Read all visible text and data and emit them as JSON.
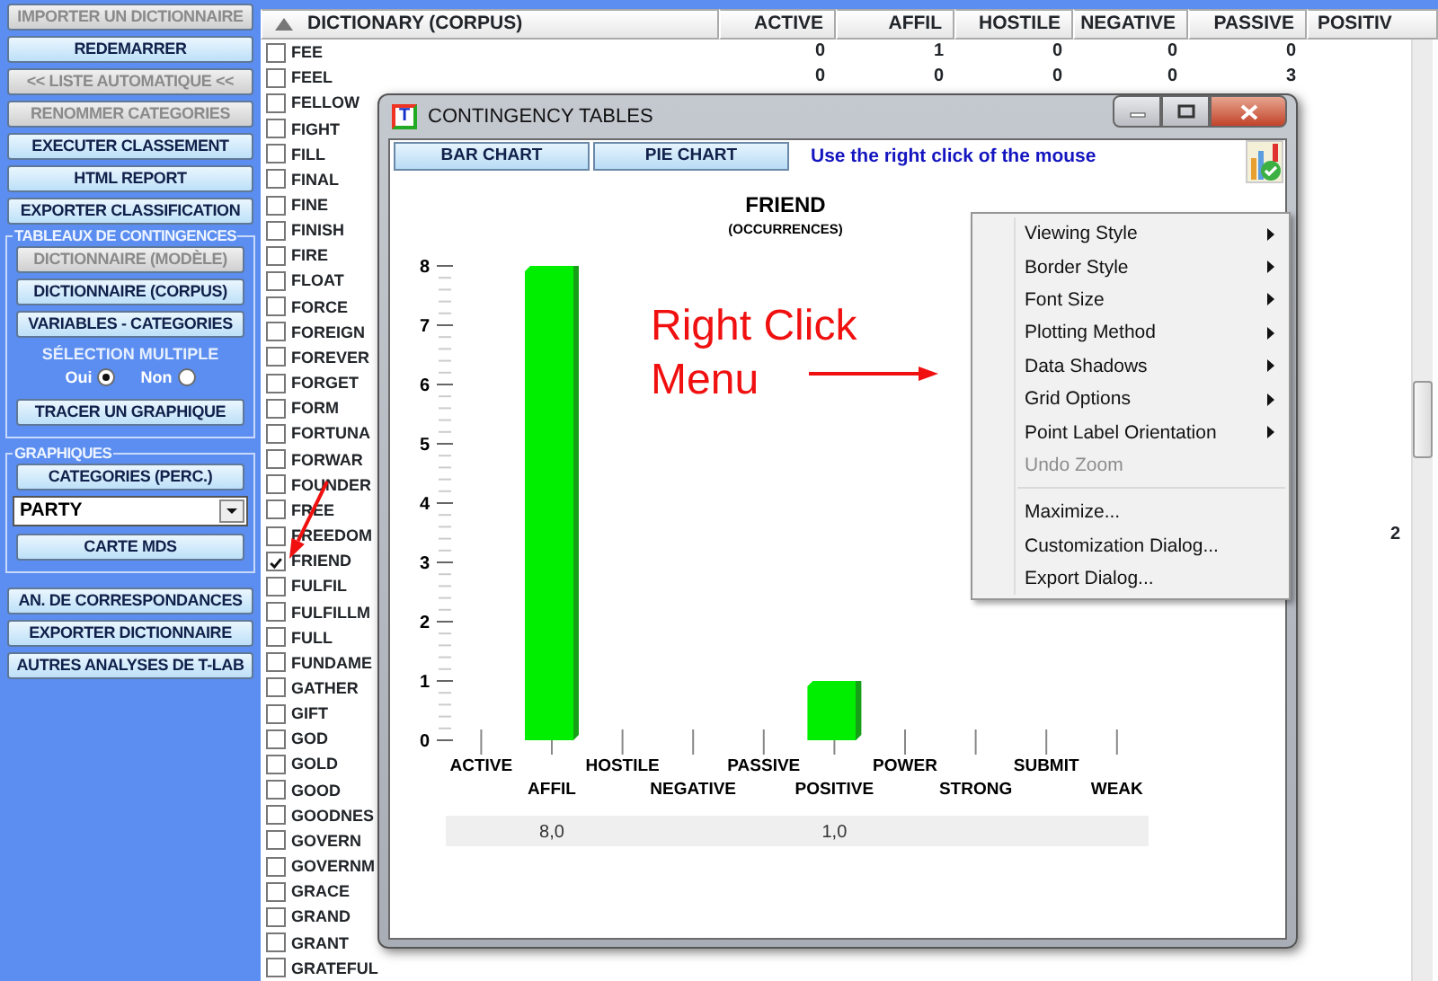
{
  "sidebar": {
    "top_buttons": [
      {
        "label": "IMPORTER UN DICTIONNAIRE",
        "disabled": true
      },
      {
        "label": "REDEMARRER",
        "disabled": false
      },
      {
        "label": "<< LISTE AUTOMATIQUE <<",
        "disabled": true
      },
      {
        "label": "RENOMMER CATEGORIES",
        "disabled": true
      },
      {
        "label": "EXECUTER CLASSEMENT",
        "disabled": false
      },
      {
        "label": "HTML REPORT",
        "disabled": false
      },
      {
        "label": "EXPORTER CLASSIFICATION",
        "disabled": false
      }
    ],
    "contingency_group": {
      "title": "TABLEAUX DE CONTINGENCES",
      "buttons": [
        {
          "label": "DICTIONNAIRE (MODÈLE)",
          "disabled": true
        },
        {
          "label": "DICTIONNAIRE (CORPUS)",
          "disabled": false
        },
        {
          "label": "VARIABLES - CATEGORIES",
          "disabled": false
        }
      ],
      "multi_select": {
        "label": "SÉLECTION MULTIPLE",
        "options": [
          {
            "label": "Oui",
            "selected": true
          },
          {
            "label": "Non",
            "selected": false
          }
        ]
      },
      "plot_button": {
        "label": "TRACER UN GRAPHIQUE",
        "disabled": false
      }
    },
    "graphics_group": {
      "title": "GRAPHIQUES",
      "buttons_before": [
        {
          "label": "CATEGORIES  (PERC.)",
          "disabled": false
        }
      ],
      "select": {
        "value": "PARTY"
      },
      "buttons_after": [
        {
          "label": "CARTE  MDS",
          "disabled": false
        }
      ]
    },
    "bottom_buttons": [
      {
        "label": "AN. DE CORRESPONDANCES",
        "disabled": false
      },
      {
        "label": "EXPORTER DICTIONNAIRE",
        "disabled": false
      },
      {
        "label": "AUTRES ANALYSES DE T-LAB",
        "disabled": false
      }
    ]
  },
  "table": {
    "columns": [
      "DICTIONARY (CORPUS)",
      "ACTIVE",
      "AFFIL",
      "HOSTILE",
      "NEGATIVE",
      "PASSIVE",
      "POSITIV"
    ],
    "rows": [
      {
        "word": "FEE",
        "checked": false,
        "values": [
          "0",
          "1",
          "0",
          "0",
          "0"
        ]
      },
      {
        "word": "FEEL",
        "checked": false,
        "values": [
          "0",
          "0",
          "0",
          "0",
          "3"
        ]
      },
      {
        "word": "FELLOW",
        "checked": false
      },
      {
        "word": "FIGHT",
        "checked": false
      },
      {
        "word": "FILL",
        "checked": false
      },
      {
        "word": "FINAL",
        "checked": false
      },
      {
        "word": "FINE",
        "checked": false
      },
      {
        "word": "FINISH",
        "checked": false
      },
      {
        "word": "FIRE",
        "checked": false
      },
      {
        "word": "FLOAT",
        "checked": false
      },
      {
        "word": "FORCE",
        "checked": false
      },
      {
        "word": "FOREIGN",
        "checked": false
      },
      {
        "word": "FOREVER",
        "checked": false
      },
      {
        "word": "FORGET",
        "checked": false
      },
      {
        "word": "FORM",
        "checked": false
      },
      {
        "word": "FORTUNA",
        "checked": false
      },
      {
        "word": "FORWAR",
        "checked": false
      },
      {
        "word": "FOUNDER",
        "checked": false
      },
      {
        "word": "FREE",
        "checked": false
      },
      {
        "word": "FREEDOM",
        "checked": false,
        "column_7": "2"
      },
      {
        "word": "FRIEND",
        "checked": true
      },
      {
        "word": "FULFIL",
        "checked": false
      },
      {
        "word": "FULFILLM",
        "checked": false
      },
      {
        "word": "FULL",
        "checked": false
      },
      {
        "word": "FUNDAME",
        "checked": false
      },
      {
        "word": "GATHER",
        "checked": false
      },
      {
        "word": "GIFT",
        "checked": false
      },
      {
        "word": "GOD",
        "checked": false
      },
      {
        "word": "GOLD",
        "checked": false
      },
      {
        "word": "GOOD",
        "checked": false
      },
      {
        "word": "GOODNES",
        "checked": false
      },
      {
        "word": "GOVERN",
        "checked": false
      },
      {
        "word": "GOVERNM",
        "checked": false
      },
      {
        "word": "GRACE",
        "checked": false
      },
      {
        "word": "GRAND",
        "checked": false
      },
      {
        "word": "GRANT",
        "checked": false
      },
      {
        "word": "GRATEFUL",
        "checked": false
      }
    ]
  },
  "dialog": {
    "icon_letter": "T",
    "title": "CONTINGENCY TABLES",
    "toolbar": {
      "buttons": [
        "BAR CHART",
        "PIE CHART"
      ],
      "hint": "Use the right click of the mouse"
    },
    "chart": {
      "subtitle": "(OCCURRENCES)",
      "chart_data": {
        "type": "bar",
        "title": "FRIEND",
        "categories": [
          "ACTIVE",
          "AFFIL",
          "HOSTILE",
          "NEGATIVE",
          "PASSIVE",
          "POSITIVE",
          "POWER",
          "STRONG",
          "SUBMIT",
          "WEAK"
        ],
        "values": [
          0,
          8,
          0,
          0,
          0,
          1,
          0,
          0,
          0,
          0
        ],
        "ylim": [
          0,
          8
        ],
        "yticks": [
          0,
          1,
          2,
          3,
          4,
          5,
          6,
          7,
          8
        ],
        "value_labels": [
          null,
          "8,0",
          null,
          null,
          null,
          "1,0",
          null,
          null,
          null,
          null
        ]
      }
    },
    "context_menu": {
      "items": [
        {
          "kind": "submenu",
          "label": "Viewing Style",
          "disabled": false
        },
        {
          "kind": "submenu",
          "label": "Border Style",
          "disabled": false
        },
        {
          "kind": "submenu",
          "label": "Font Size",
          "disabled": false
        },
        {
          "kind": "submenu",
          "label": "Plotting Method",
          "disabled": false
        },
        {
          "kind": "submenu",
          "label": "Data Shadows",
          "disabled": false
        },
        {
          "kind": "submenu",
          "label": "Grid Options",
          "disabled": false
        },
        {
          "kind": "submenu",
          "label": "Point Label Orientation",
          "disabled": false
        },
        {
          "kind": "action",
          "label": "Undo Zoom",
          "disabled": true
        },
        {
          "kind": "separator"
        },
        {
          "kind": "action",
          "label": "Maximize...",
          "disabled": false
        },
        {
          "kind": "action",
          "label": "Customization Dialog...",
          "disabled": false
        },
        {
          "kind": "action",
          "label": "Export Dialog...",
          "disabled": false
        }
      ]
    }
  },
  "annotation": {
    "text": "Right Click\nMenu"
  }
}
